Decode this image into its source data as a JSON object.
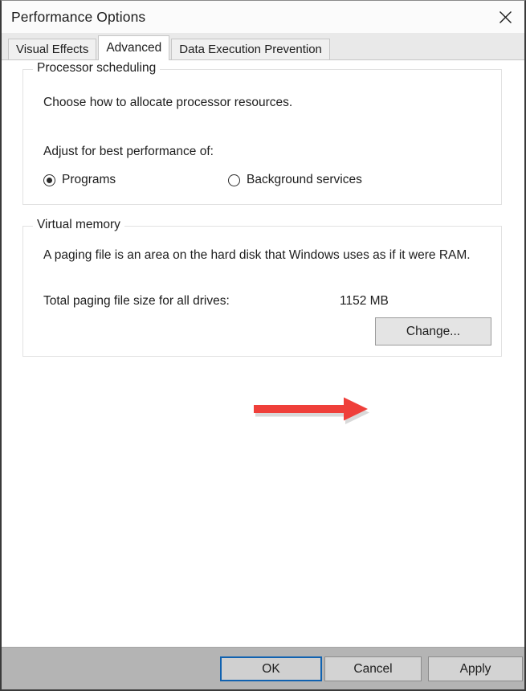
{
  "window": {
    "title": "Performance Options",
    "close_icon": "close-icon"
  },
  "tabs": [
    {
      "label": "Visual Effects",
      "selected": false
    },
    {
      "label": "Advanced",
      "selected": true
    },
    {
      "label": "Data Execution Prevention",
      "selected": false
    }
  ],
  "processor_scheduling": {
    "legend": "Processor scheduling",
    "description": "Choose how to allocate processor resources.",
    "adjust_label": "Adjust for best performance of:",
    "options": [
      {
        "label": "Programs",
        "selected": true
      },
      {
        "label": "Background services",
        "selected": false
      }
    ]
  },
  "virtual_memory": {
    "legend": "Virtual memory",
    "description": "A paging file is an area on the hard disk that Windows uses as if it were RAM.",
    "total_label": "Total paging file size for all drives:",
    "total_value": "1152 MB",
    "change_button": "Change..."
  },
  "annotation": {
    "type": "arrow",
    "direction": "right",
    "color": "#ef3f3a",
    "points_to": "Change..."
  },
  "footer": {
    "ok_label": "OK",
    "cancel_label": "Cancel",
    "apply_label": "Apply",
    "default_button": "OK"
  },
  "colors": {
    "accent_focus": "#1062b0",
    "annotation_red": "#ef3f3a",
    "footer_bg": "#b4b4b4",
    "tabstrip_bg": "#e9e9e9"
  }
}
